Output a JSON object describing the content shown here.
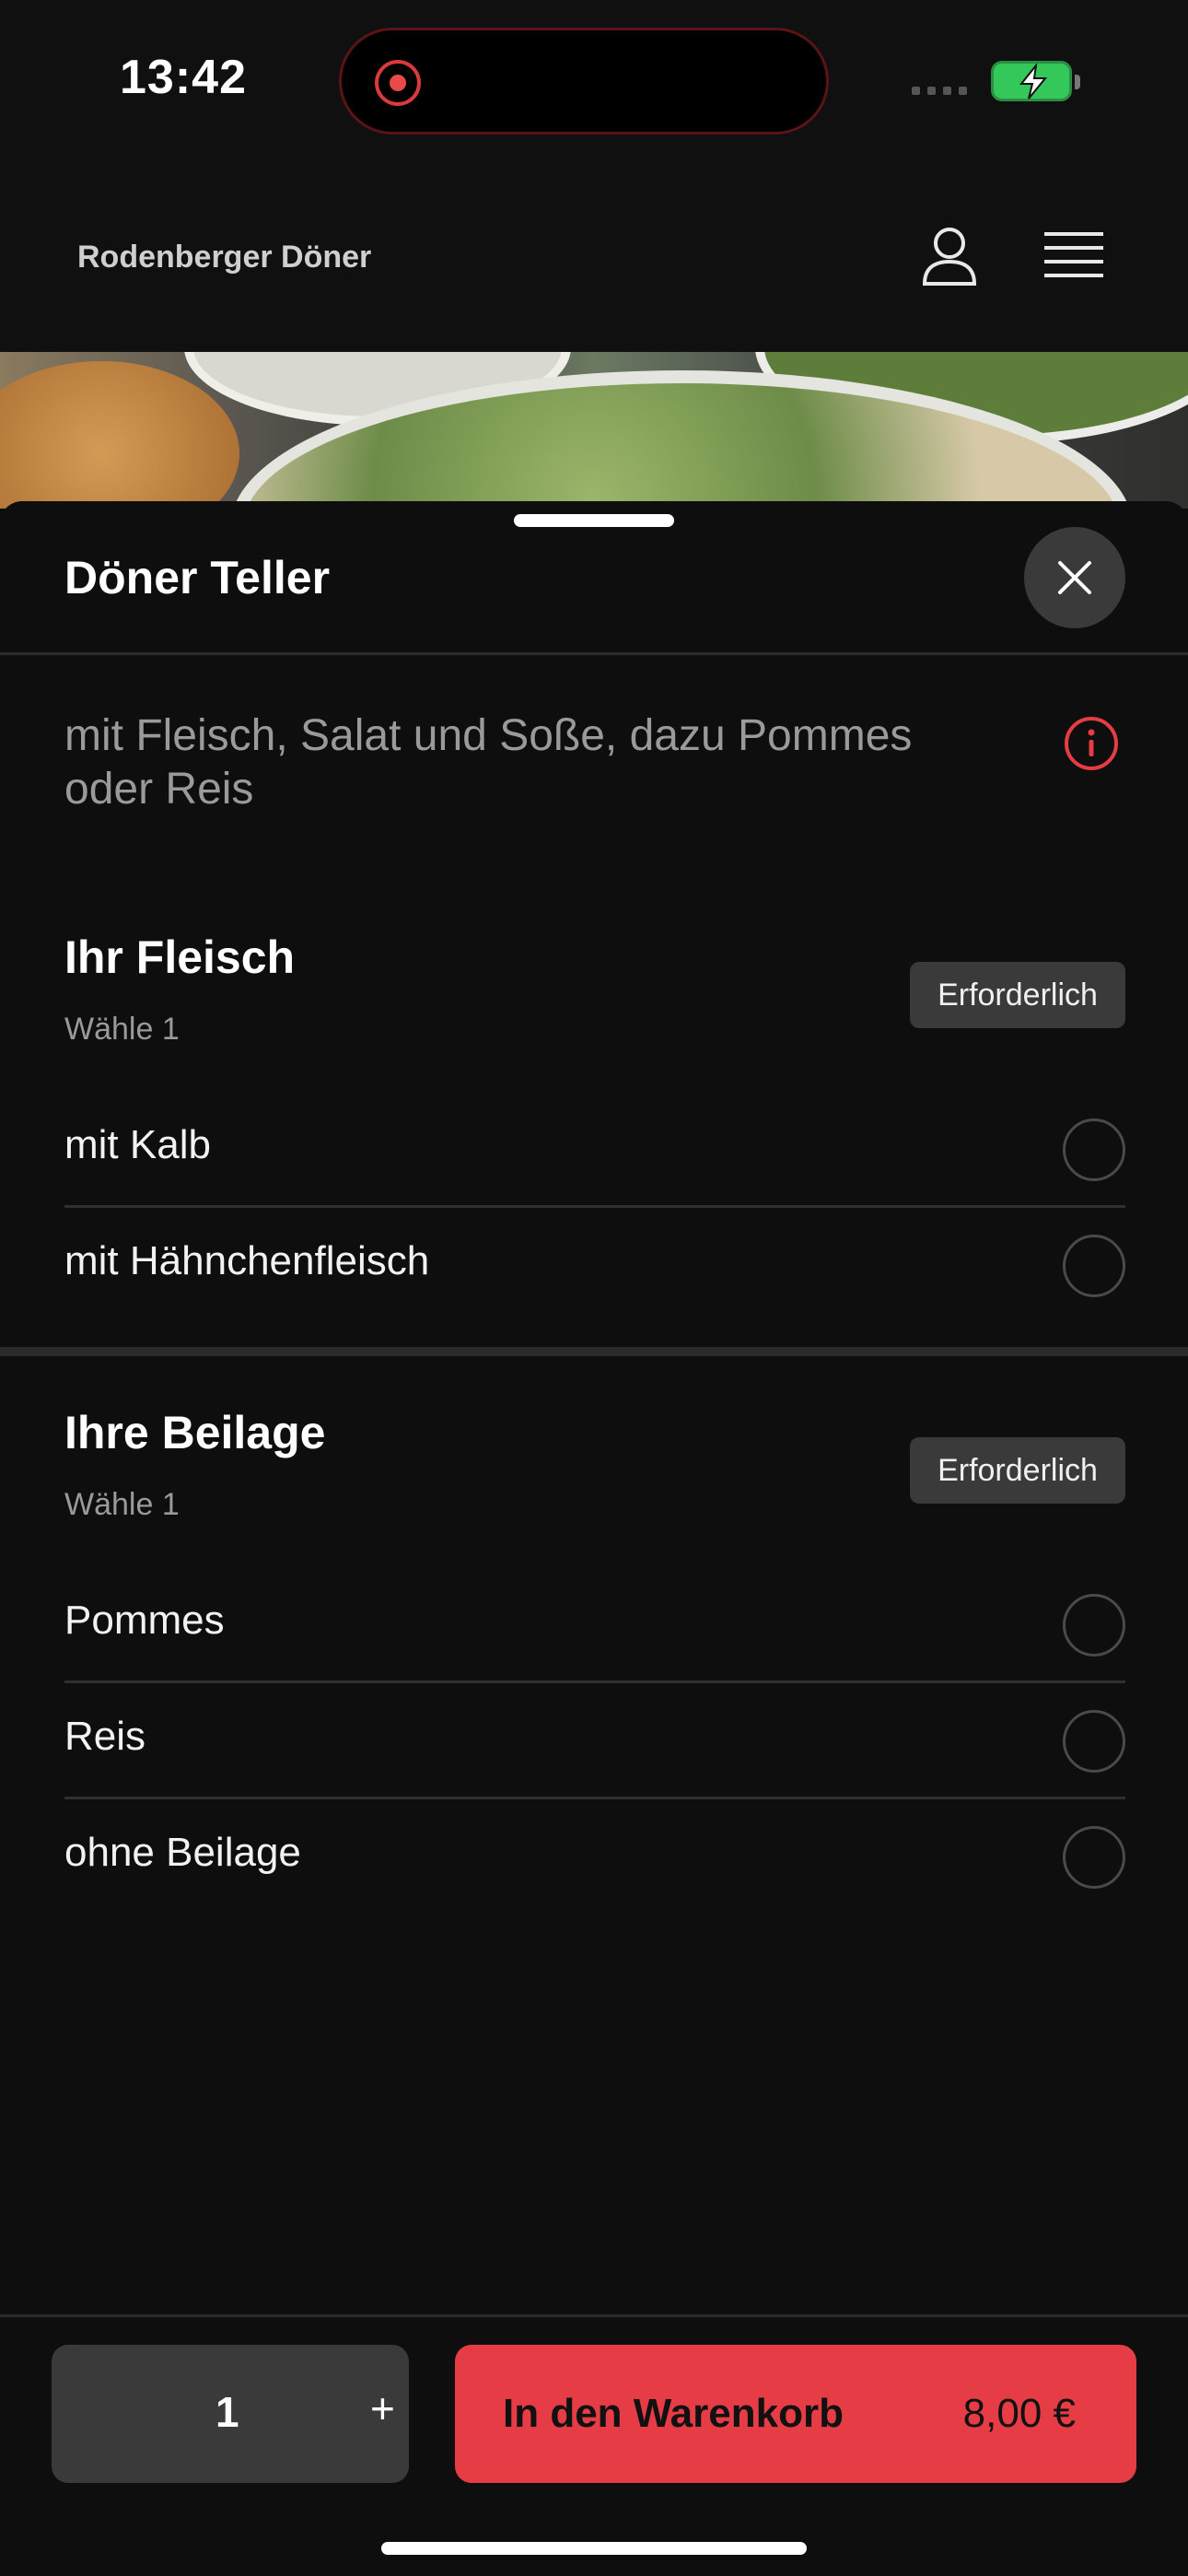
{
  "status_bar": {
    "time": "13:42"
  },
  "header": {
    "brand": "Rodenberger Döner"
  },
  "product": {
    "title": "Döner Teller",
    "description": "mit Fleisch, Salat und Soße, dazu Pommes oder Reis"
  },
  "sections": [
    {
      "title": "Ihr Fleisch",
      "subtitle": "Wähle 1",
      "badge": "Erforderlich",
      "options": [
        "mit Kalb",
        "mit Hähnchenfleisch"
      ]
    },
    {
      "title": "Ihre Beilage",
      "subtitle": "Wähle 1",
      "badge": "Erforderlich",
      "options": [
        "Pommes",
        "Reis",
        "ohne Beilage"
      ]
    }
  ],
  "footer": {
    "quantity": "1",
    "plus": "+",
    "cart_label": "In den Warenkorb",
    "price": "8,00 €"
  },
  "colors": {
    "accent": "#e63c45",
    "background": "#0d0d0d",
    "battery": "#34c759"
  },
  "icons": [
    "record-icon",
    "battery-icon",
    "user-icon",
    "menu-icon",
    "close-icon",
    "info-icon"
  ]
}
